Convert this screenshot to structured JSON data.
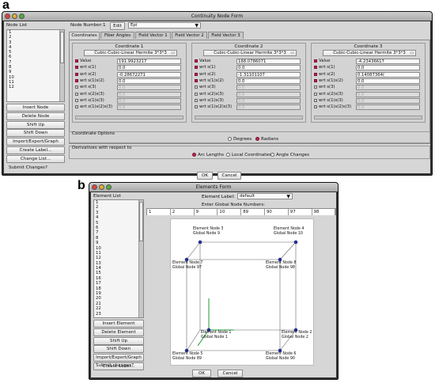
{
  "panel_a": {
    "letter": "a",
    "title": "Continuity Node Form",
    "node_list_label": "Node List",
    "node_list": [
      "1",
      "2",
      "3",
      "4",
      "5",
      "6",
      "7",
      "8",
      "9",
      "10",
      "11",
      "12"
    ],
    "side_buttons": [
      "Insert Node",
      "Delete Node",
      "Shift Up",
      "Shift Down",
      "Import/Export/Graph",
      "Create Label...",
      "Change List..."
    ],
    "node_number_label": "Node Number:",
    "node_number_value": "1",
    "edit_label": "Edit",
    "epi_value": "Epi",
    "tabs": [
      "Coordinates",
      "Fiber Angles",
      "Field Vector 1",
      "Field Vector 2",
      "Field Vector 3"
    ],
    "coordinates": [
      {
        "header": "Coordinate 1",
        "basis": "Cubic-Cubic-Linear Hermite 3*3*3",
        "rows": [
          {
            "label": "Value",
            "value": "191.9923217"
          },
          {
            "label": "wrt s(1)",
            "value": "0.0"
          },
          {
            "label": "wrt s(2)",
            "value": "-0.28672271"
          },
          {
            "label": "wrt s(1)s(2)",
            "value": "0.0"
          },
          {
            "label": "wrt s(3)",
            "value": "0.0"
          },
          {
            "label": "wrt s(2)s(3)",
            "value": "0.0"
          },
          {
            "label": "wrt s(1)s(3)",
            "value": "0.0"
          },
          {
            "label": "wrt s(1)s(2)s(3)",
            "value": "0.0"
          }
        ]
      },
      {
        "header": "Coordinate 2",
        "basis": "Cubic-Cubic-Linear Hermite 3*3*3",
        "rows": [
          {
            "label": "Value",
            "value": "188.0786071"
          },
          {
            "label": "wrt s(1)",
            "value": "0.0"
          },
          {
            "label": "wrt s(2)",
            "value": "-1.31101107"
          },
          {
            "label": "wrt s(1)s(2)",
            "value": "0.0"
          },
          {
            "label": "wrt s(3)",
            "value": "0.0"
          },
          {
            "label": "wrt s(2)s(3)",
            "value": "0.0"
          },
          {
            "label": "wrt s(1)s(3)",
            "value": "0.0"
          },
          {
            "label": "wrt s(1)s(2)s(3)",
            "value": "0.0"
          }
        ]
      },
      {
        "header": "Coordinate 3",
        "basis": "Cubic-Cubic-Linear Hermite 3*3*3",
        "rows": [
          {
            "label": "Value",
            "value": "-4.23436617"
          },
          {
            "label": "wrt s(1)",
            "value": "0.0"
          },
          {
            "label": "wrt s(2)",
            "value": "0.14087364("
          },
          {
            "label": "wrt s(1)s(2)",
            "value": "0.0"
          },
          {
            "label": "wrt s(3)",
            "value": "0.0"
          },
          {
            "label": "wrt s(2)s(3)",
            "value": "0.0"
          },
          {
            "label": "wrt s(1)s(3)",
            "value": "0.0"
          },
          {
            "label": "wrt s(1)s(2)s(3)",
            "value": "0.0"
          }
        ]
      }
    ],
    "coordinate_options_label": "Coordinate Options",
    "degrees_label": "Degrees",
    "radians_label": "Radians",
    "derivatives_label": "Derivatives with respect to",
    "arc_lengths_label": "Arc Lengths",
    "local_coords_label": "Local Coordinates",
    "angle_changes_label": "Angle Changes",
    "submit_label": "Submit Changes?",
    "ok_label": "OK",
    "cancel_label": "Cancel"
  },
  "panel_b": {
    "letter": "b",
    "title": "Elements Form",
    "element_list_label": "Element List",
    "element_list": [
      "1",
      "2",
      "3",
      "4",
      "5",
      "6",
      "7",
      "8",
      "9",
      "10",
      "11",
      "12",
      "13",
      "14",
      "15",
      "16",
      "17",
      "18",
      "19",
      "20",
      "21",
      "22",
      "23"
    ],
    "side_buttons": [
      "Insert Element",
      "Delete Element",
      "Shift Up",
      "Shift Down",
      "Import/Export/Graph",
      "Create Label..."
    ],
    "element_label_label": "Element Label:",
    "element_label_value": "default",
    "global_nodes_label": "Enter Global Node Numbers:",
    "global_nodes": [
      "1",
      "2",
      "9",
      "10",
      "89",
      "90",
      "97",
      "98"
    ],
    "cube_nodes": [
      {
        "element_node": "Element Node 3",
        "global_node": "Global Node 9"
      },
      {
        "element_node": "Element Node 4",
        "global_node": "Global Node 10"
      },
      {
        "element_node": "Element Node 7",
        "global_node": "Global Node 97"
      },
      {
        "element_node": "Element Node 8",
        "global_node": "Global Node 98"
      },
      {
        "element_node": "Element Node 1",
        "global_node": "Global Node 1"
      },
      {
        "element_node": "Element Node 2",
        "global_node": "Global Node 2"
      },
      {
        "element_node": "Element Node 5",
        "global_node": "Global Node 89"
      },
      {
        "element_node": "Element Node 6",
        "global_node": "Global Node 90"
      }
    ],
    "submit_label": "Submit changes?",
    "ok_label": "OK",
    "cancel_label": "Cancel"
  },
  "colors": {
    "radio_selected": "#c1224b",
    "node_dot": "#23308f",
    "axis_green": "#1f9c2f"
  }
}
